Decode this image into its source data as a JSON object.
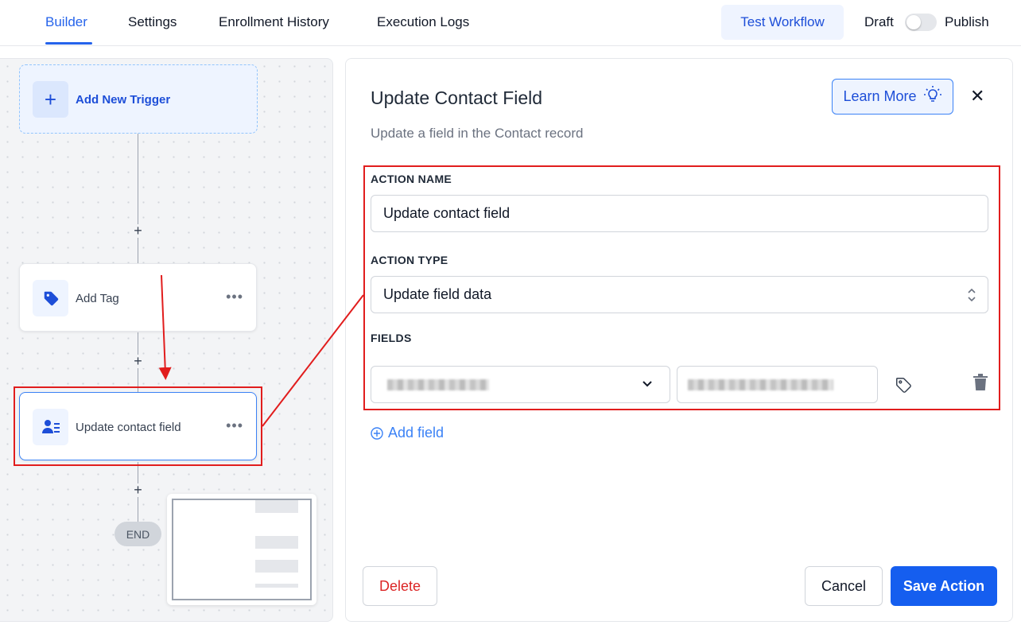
{
  "tabs": [
    {
      "label": "Builder",
      "active": true
    },
    {
      "label": "Settings",
      "active": false
    },
    {
      "label": "Enrollment History",
      "active": false
    },
    {
      "label": "Execution Logs",
      "active": false
    }
  ],
  "header": {
    "test_label": "Test Workflow",
    "draft_label": "Draft",
    "publish_label": "Publish",
    "publish_enabled": false
  },
  "canvas": {
    "trigger_label": "Add New Trigger",
    "nodes": [
      {
        "label": "Add Tag",
        "icon": "tag-icon"
      },
      {
        "label": "Update contact field",
        "icon": "contact-list-icon"
      }
    ],
    "end_label": "END"
  },
  "panel": {
    "title": "Update Contact Field",
    "subtitle": "Update a field in the Contact record",
    "learn_more_label": "Learn More",
    "action_name_label": "ACTION NAME",
    "action_name_value": "Update contact field",
    "action_type_label": "ACTION TYPE",
    "action_type_value": "Update field data",
    "fields_label": "FIELDS",
    "add_field_label": "Add field",
    "delete_label": "Delete",
    "cancel_label": "Cancel",
    "save_label": "Save Action"
  },
  "colors": {
    "accent": "#2563eb",
    "primary_button": "#155eef",
    "danger": "#dc2626",
    "annotation": "#e11d1d"
  }
}
